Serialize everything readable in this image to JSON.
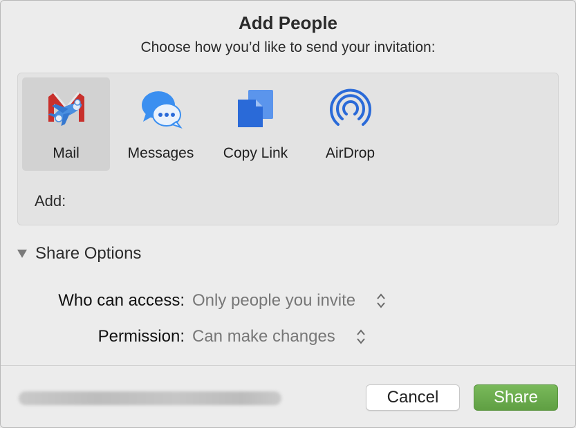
{
  "dialog": {
    "title": "Add People",
    "subtitle": "Choose how you’d like to send your invitation:"
  },
  "services": [
    {
      "label": "Mail",
      "icon": "mail-icon",
      "selected": true
    },
    {
      "label": "Messages",
      "icon": "messages-icon",
      "selected": false
    },
    {
      "label": "Copy Link",
      "icon": "copy-link-icon",
      "selected": false
    },
    {
      "label": "AirDrop",
      "icon": "airdrop-icon",
      "selected": false
    }
  ],
  "add": {
    "label": "Add:",
    "value": ""
  },
  "share_options": {
    "label": "Share Options",
    "expanded": true,
    "who_can_access": {
      "label": "Who can access:",
      "value": "Only people you invite"
    },
    "permission": {
      "label": "Permission:",
      "value": "Can make changes"
    }
  },
  "footer": {
    "cancel_label": "Cancel",
    "share_label": "Share"
  },
  "colors": {
    "share_button": "#6aad4d",
    "icon_blue": "#2a6ad8",
    "messages_blue": "#2b8ff3"
  }
}
